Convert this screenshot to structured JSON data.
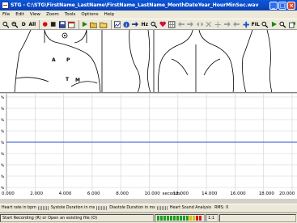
{
  "window": {
    "title": "STG - C:\\STG\\FirstName_LastName\\FirstName_LastName_MonthDateYear_HourMinSec.wav",
    "min_label": "_",
    "max_label": "□",
    "close_label": "×"
  },
  "menu": [
    "File",
    "Edit",
    "View",
    "Zoom",
    "Tools",
    "Options",
    "Help"
  ],
  "toolbar": {
    "d_label": "D",
    "all_label": "All",
    "hz_label": "Hz",
    "fil_label": "FIL"
  },
  "body_labels": {
    "a": "A",
    "p": "P",
    "t": "T",
    "m": "M"
  },
  "plot": {
    "y_unit": "%",
    "trace_color": "#2a4fd6",
    "x_ticks": [
      "0.000",
      "2.000",
      "4.000",
      "6.000",
      "8.000",
      "10.000",
      "12.000",
      "14.000",
      "16.000",
      "18.000",
      "20.000"
    ],
    "x_unit": "seconds"
  },
  "info": {
    "heart_rate": "Heart rate in bpm",
    "systole": "Systole Duration in ms",
    "diastole": "Diastole Duration in ms",
    "analysis": "Heart Sound Analysis",
    "rms": "RMS:",
    "rms_value": "0"
  },
  "status": {
    "message": "Start Recording (R) or Open an existing file (O)",
    "channel": "1:1"
  }
}
